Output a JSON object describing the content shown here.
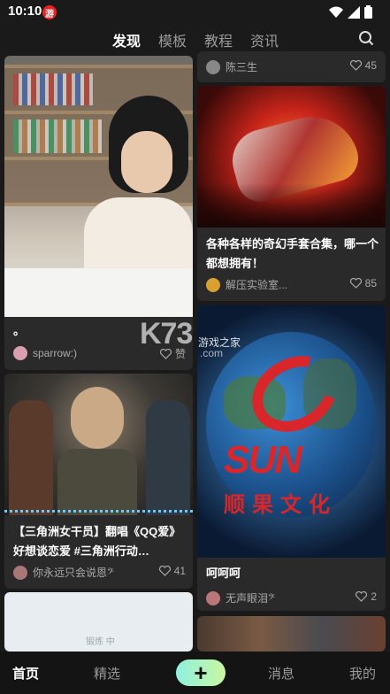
{
  "status": {
    "time": "10:10",
    "notif_badge": "游"
  },
  "tabs": [
    {
      "label": "发现",
      "active": true
    },
    {
      "label": "模板"
    },
    {
      "label": "教程"
    },
    {
      "label": "资讯"
    }
  ],
  "feed": {
    "left": [
      {
        "title": "。",
        "author": "sparrow:)",
        "likes": "赞"
      },
      {
        "title": "【三角洲女干员】翻唱《QQ爱》好想谈恋爱 #三角洲行动…",
        "author": "你永远只会说恩𝄢",
        "likes": "41"
      },
      {
        "image_text": "锻炼 中"
      }
    ],
    "right": [
      {
        "author": "陈三生",
        "likes": "45"
      },
      {
        "title": "各种各样的奇幻手套合集，哪一个都想拥有！",
        "author": "解压实验室...",
        "likes": "85"
      },
      {
        "image_text_1": "SUN",
        "image_text_2": "顺果文化",
        "title": "呵呵呵",
        "author": "无声眼泪𝄢",
        "likes": "2"
      }
    ]
  },
  "watermark": {
    "brand": "K73",
    "sub": "游戏之家",
    "domain": ".com"
  },
  "bottom_nav": [
    {
      "label": "首页",
      "active": true
    },
    {
      "label": "精选"
    },
    {
      "label": "+"
    },
    {
      "label": "消息"
    },
    {
      "label": "我的"
    }
  ],
  "colors": {
    "background": "#1a1a1a",
    "accent_gradient_start": "#8ff0e0",
    "accent_gradient_end": "#c9f7a0"
  }
}
